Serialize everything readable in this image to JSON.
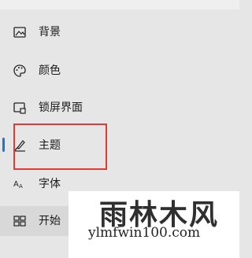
{
  "nav": {
    "items": [
      {
        "label": "背景",
        "icon": "picture-icon"
      },
      {
        "label": "颜色",
        "icon": "palette-icon"
      },
      {
        "label": "锁屏界面",
        "icon": "lock-screen-icon"
      },
      {
        "label": "主题",
        "icon": "theme-brush-icon",
        "selected": true
      },
      {
        "label": "字体",
        "icon": "font-icon"
      },
      {
        "label": "开始",
        "icon": "start-grid-icon"
      }
    ]
  },
  "highlight_color": "#e53935",
  "accent_color": "#1a73e8",
  "watermark": {
    "title": "雨林木风",
    "subtitle": "ylmfwin100.com"
  }
}
